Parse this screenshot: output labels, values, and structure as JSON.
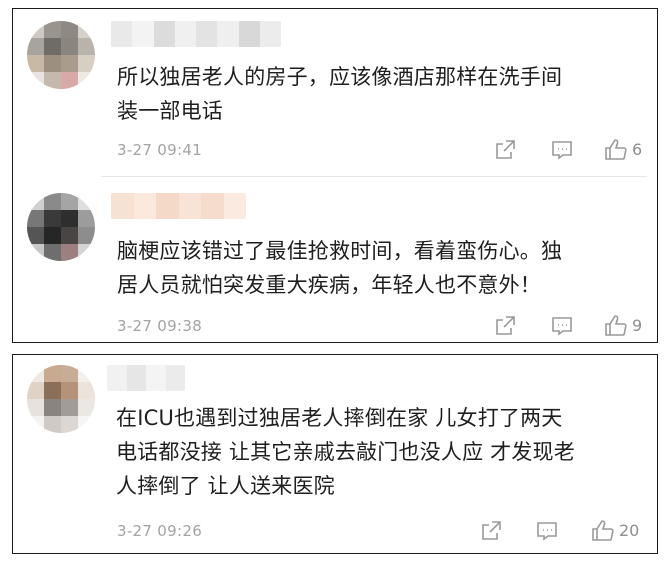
{
  "comments": [
    {
      "text_lines": [
        "所以独居老人的房子，应该像酒店那样在洗手间",
        "装一部电话"
      ],
      "time": "3-27 09:41",
      "likes": "6",
      "icons": [
        "share-icon",
        "reply-icon",
        "thumbs-up-icon"
      ]
    },
    {
      "text_lines": [
        "脑梗应该错过了最佳抢救时间，看着蛮伤心。独",
        "居人员就怕突发重大疾病，年轻人也不意外！"
      ],
      "time": "3-27 09:38",
      "likes": "9",
      "icons": [
        "share-icon",
        "reply-icon",
        "thumbs-up-icon"
      ]
    },
    {
      "text_lines": [
        "在ICU也遇到过独居老人摔倒在家 儿女打了两天",
        "电话都没接 让其它亲戚去敲门也没人应 才发现老",
        "人摔倒了 让人送来医院"
      ],
      "time": "3-27 09:26",
      "likes": "20",
      "icons": [
        "share-icon",
        "reply-icon",
        "thumbs-up-icon"
      ]
    }
  ],
  "colors": {
    "text": "#1f1f1f",
    "meta": "#a3a3a3",
    "icon": "#9a9a9a",
    "border": "#1a1a1a",
    "divider": "#e8e8e8"
  }
}
